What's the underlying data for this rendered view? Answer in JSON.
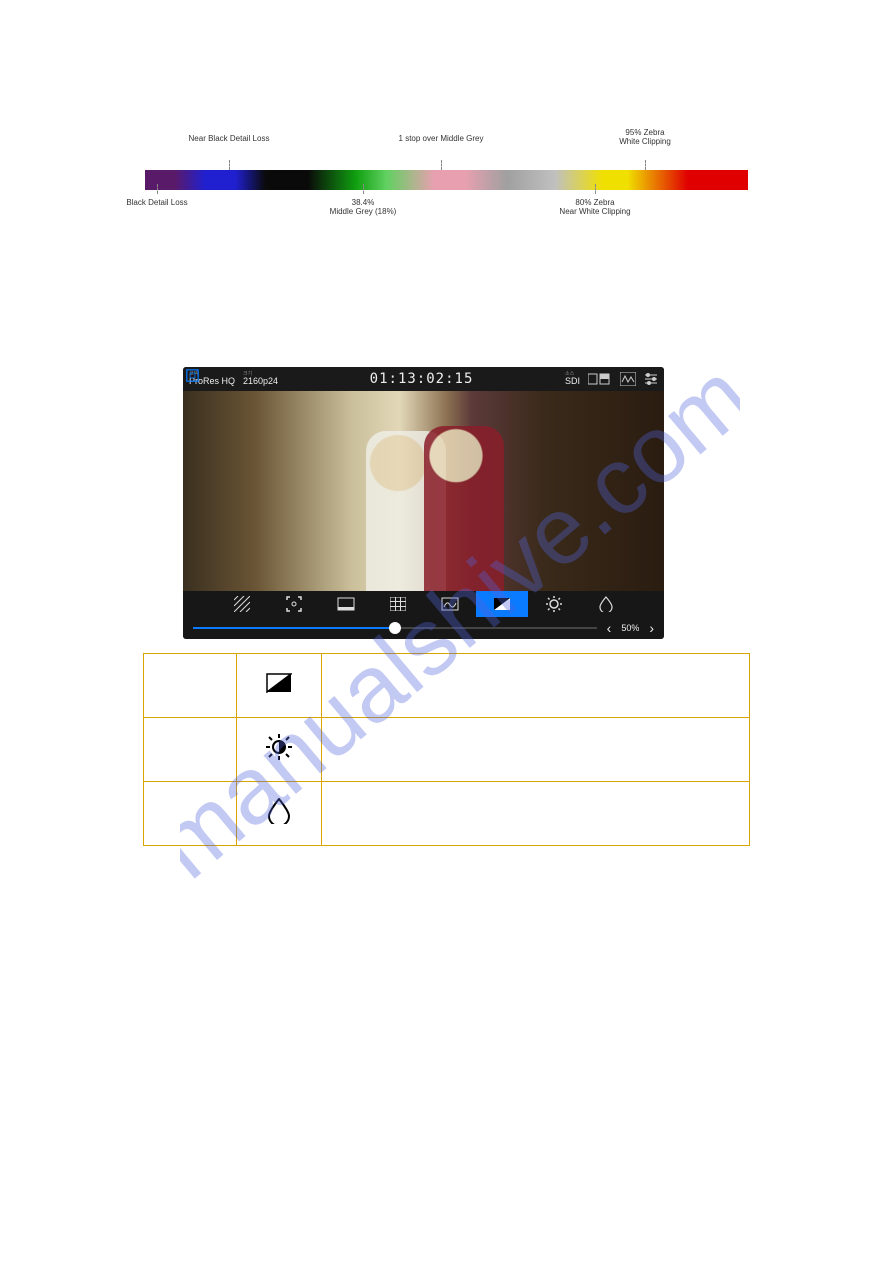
{
  "diagram": {
    "top_labels": {
      "near_black": "Near Black Detail Loss",
      "one_stop": "1 stop over Middle Grey",
      "zebra95": "95% Zebra\nWhite Clipping"
    },
    "bottom_labels": {
      "black_loss": "Black Detail Loss",
      "middle_grey": "38.4%\nMiddle Grey (18%)",
      "zebra80": "80% Zebra\nNear White Clipping"
    }
  },
  "monitor": {
    "codec_small": "코덱",
    "codec": "ProRes HQ",
    "res_small": "크기",
    "res": "2160p24",
    "timecode": "01:13:02:15",
    "src_small": "소스",
    "src": "SDI",
    "slider_value": "50%"
  },
  "icons": {
    "zebra": "zebra",
    "brightness": "brightness",
    "drop": "drop"
  }
}
